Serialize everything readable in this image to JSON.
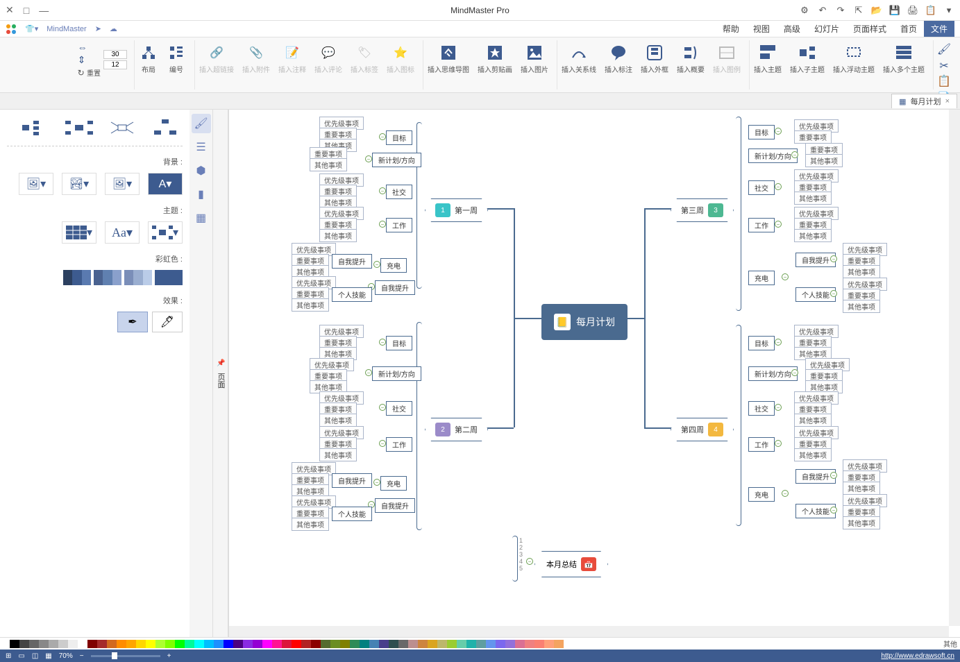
{
  "app": {
    "title": "MindMaster Pro",
    "doc_name": "MindMaster"
  },
  "titlebar_right_icons": [
    "▾",
    "📋",
    "🖨",
    "💾",
    "📄",
    "↪",
    "↩",
    "↻",
    "↺",
    "⚙"
  ],
  "menu_tabs": [
    "文件",
    "首页",
    "页面样式",
    "幻灯片",
    "高级",
    "视图",
    "帮助"
  ],
  "menu_active": "首页",
  "ribbon": {
    "topic": {
      "main": "插入主题",
      "sub": "插入子主题",
      "float": "插入浮动主题",
      "multi": "插入多个主题"
    },
    "rel": {
      "rel": "插入关系线",
      "callout": "插入标注",
      "outline": "插入外框",
      "summary": "插入概要",
      "table": "插入图例"
    },
    "media": {
      "mindmap": "插入思维导图",
      "clipart": "插入剪贴画",
      "image": "插入图片"
    },
    "attach": {
      "hyperlink": "插入超链接",
      "attach": "插入附件",
      "note": "插入注释",
      "comment": "插入评论",
      "tag": "插入标签",
      "icon": "插入图标"
    },
    "layout": {
      "l1": "布局",
      "l2": "编号",
      "reset": "重置"
    },
    "spin": {
      "v1": "30",
      "v2": "12"
    }
  },
  "doc_tab": {
    "label": "每月计划",
    "close": "×"
  },
  "panel": {
    "title": "页面",
    "sections": {
      "bg": "背景 :",
      "theme": "主题 :",
      "colors": "彩虹色 :",
      "effect": "效果 :"
    }
  },
  "mindmap": {
    "root": "每月计划",
    "weeks": [
      {
        "id": "w1",
        "label": "第一周",
        "color": "#39c4c8",
        "num": "1"
      },
      {
        "id": "w2",
        "label": "第二周",
        "color": "#9b8bc9",
        "num": "2"
      },
      {
        "id": "w3",
        "label": "第三周",
        "color": "#4db892",
        "num": "3"
      },
      {
        "id": "w4",
        "label": "第四周",
        "color": "#f3b83f",
        "num": "4"
      }
    ],
    "cats": {
      "goal": "目标",
      "plan": "新计划/方向",
      "social": "社交",
      "work": "工作",
      "charge": "充电",
      "review": "自我提升",
      "personal": "个人技能"
    },
    "leaves": {
      "first": "优先级事项",
      "important": "重要事项",
      "other": "其他事项"
    },
    "summary": "本月总结",
    "numbers": [
      "1",
      "2",
      "3",
      "4",
      "5"
    ]
  },
  "colorstrip_label": "其他",
  "statusbar": {
    "url": "http://www.edrawsoft.cn",
    "zoom": "70%"
  }
}
